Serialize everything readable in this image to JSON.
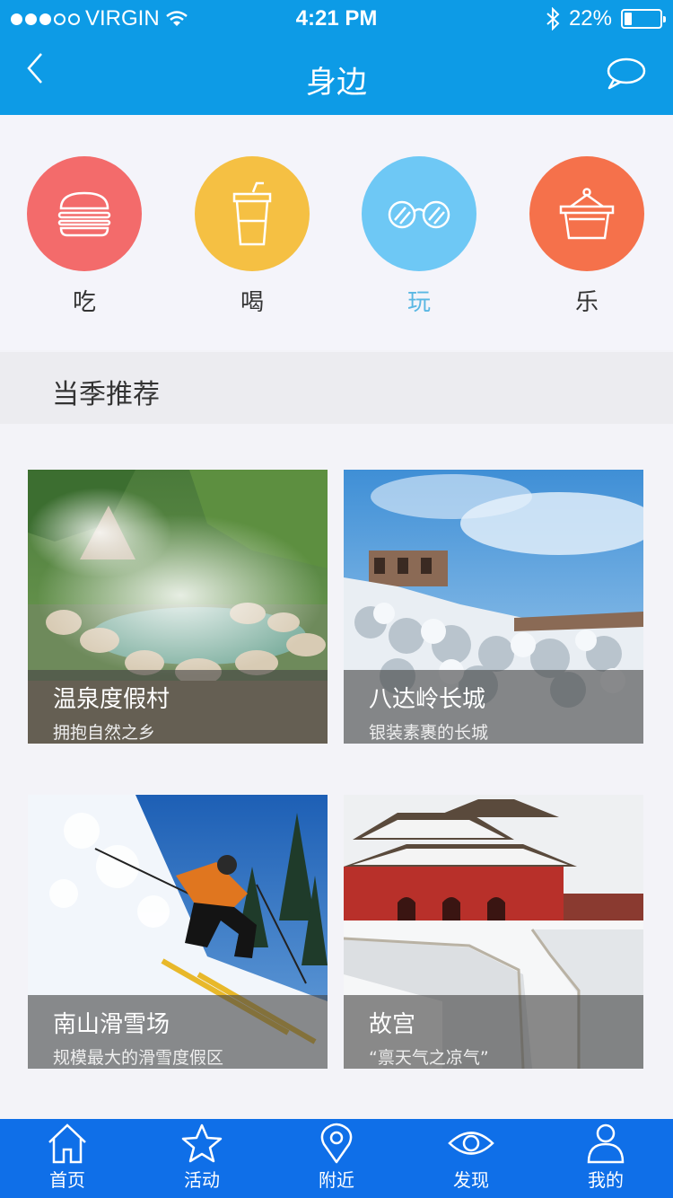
{
  "status_bar": {
    "carrier": "VIRGIN",
    "time": "4:21 PM",
    "battery": "22%",
    "battery_level": 0.22
  },
  "nav": {
    "title": "身边"
  },
  "categories": [
    {
      "label": "吃",
      "color": "#f36b6b",
      "icon": "burger-icon"
    },
    {
      "label": "喝",
      "color": "#f5c043",
      "icon": "drink-cup-icon"
    },
    {
      "label": "玩",
      "color": "#6ec8f5",
      "icon": "sunglasses-icon",
      "active": true
    },
    {
      "label": "乐",
      "color": "#f5714b",
      "icon": "basket-icon"
    }
  ],
  "section": {
    "title": "当季推荐"
  },
  "cards": [
    {
      "name": "温泉度假村",
      "desc": "拥抱自然之乡"
    },
    {
      "name": "八达岭长城",
      "desc": "银装素裹的长城"
    },
    {
      "name": "南山滑雪场",
      "desc": "规模最大的滑雪度假区"
    },
    {
      "name": "故宫",
      "desc": "“禀天气之凉气”"
    }
  ],
  "tabs": [
    {
      "label": "首页",
      "icon": "home-icon"
    },
    {
      "label": "活动",
      "icon": "star-icon"
    },
    {
      "label": "附近",
      "icon": "location-pin-icon"
    },
    {
      "label": "发现",
      "icon": "eye-icon"
    },
    {
      "label": "我的",
      "icon": "user-icon"
    }
  ],
  "colors": {
    "header": "#0d9be6",
    "tabbar": "#0f6fe8",
    "active_label": "#5ab7e3"
  }
}
